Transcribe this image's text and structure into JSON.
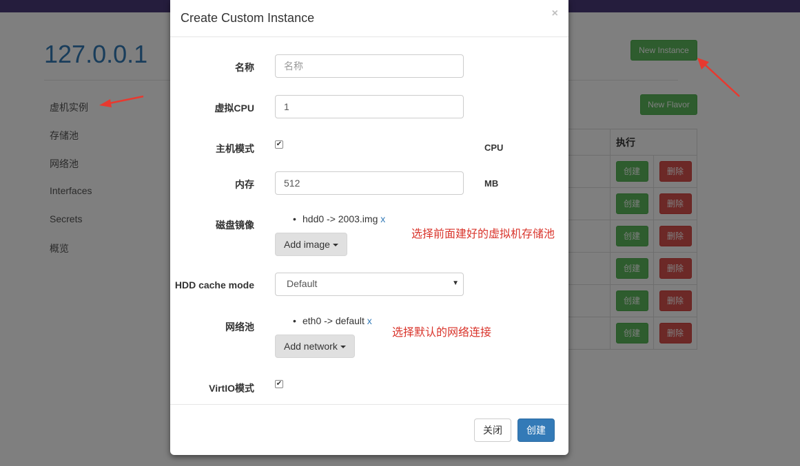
{
  "background": {
    "host_title": "127.0.0.1",
    "sidebar": {
      "items": [
        "虚机实例",
        "存储池",
        "网络池",
        "Interfaces",
        "Secrets",
        "概览"
      ]
    },
    "new_instance_label": "New Instance",
    "new_flavor_label": "New Flavor",
    "table": {
      "action_header": "执行",
      "rows": [
        {
          "create": "创建",
          "delete": "删除"
        },
        {
          "create": "创建",
          "delete": "删除"
        },
        {
          "create": "创建",
          "delete": "删除"
        },
        {
          "create": "创建",
          "delete": "删除"
        },
        {
          "create": "创建",
          "delete": "删除"
        },
        {
          "create": "创建",
          "delete": "删除"
        }
      ]
    }
  },
  "modal": {
    "title": "Create Custom Instance",
    "close_symbol": "×",
    "fields": {
      "name": {
        "label": "名称",
        "value": "",
        "placeholder": "名称"
      },
      "vcpu": {
        "label": "虚拟CPU",
        "value": "1"
      },
      "host_model": {
        "label": "主机模式",
        "checked": true,
        "unit": "CPU"
      },
      "memory": {
        "label": "内存",
        "value": "512",
        "unit": "MB"
      },
      "disk_image": {
        "label": "磁盘镜像",
        "item_text": "hdd0 -> 2003.img",
        "remove_symbol": "x",
        "add_label": "Add image"
      },
      "cache_mode": {
        "label": "HDD cache mode",
        "selected": "Default"
      },
      "network": {
        "label": "网络池",
        "item_text": "eth0 -> default",
        "remove_symbol": "x",
        "add_label": "Add network"
      },
      "virtio": {
        "label": "VirtIO模式",
        "checked": true
      }
    },
    "footer": {
      "close_label": "关闭",
      "create_label": "创建"
    }
  },
  "annotations": {
    "disk_note": "选择前面建好的虚拟机存储池",
    "network_note": "选择默认的网络连接"
  },
  "colors": {
    "navbar": "#4b3b7a",
    "primary": "#337ab7",
    "success": "#5cb85c",
    "danger": "#d9534f",
    "annotation_red": "#d9342b"
  }
}
